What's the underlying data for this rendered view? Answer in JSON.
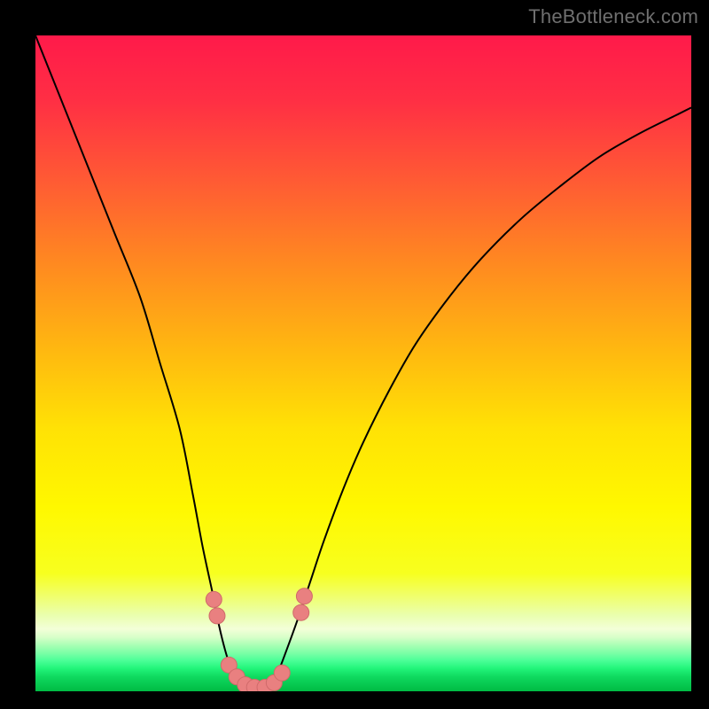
{
  "watermark": "TheBottleneck.com",
  "colors": {
    "frame": "#000000",
    "curve": "#000000",
    "marker_fill": "#e98080",
    "marker_stroke": "#d06a6a",
    "gradient_stops": [
      {
        "offset": 0.0,
        "color": "#ff1a4a"
      },
      {
        "offset": 0.1,
        "color": "#ff2f44"
      },
      {
        "offset": 0.22,
        "color": "#ff5a34"
      },
      {
        "offset": 0.35,
        "color": "#ff8a20"
      },
      {
        "offset": 0.48,
        "color": "#ffb810"
      },
      {
        "offset": 0.6,
        "color": "#ffe205"
      },
      {
        "offset": 0.72,
        "color": "#fff800"
      },
      {
        "offset": 0.82,
        "color": "#f7ff1f"
      },
      {
        "offset": 0.885,
        "color": "#eaffb0"
      },
      {
        "offset": 0.905,
        "color": "#f3ffd8"
      },
      {
        "offset": 0.918,
        "color": "#d6ffc8"
      },
      {
        "offset": 0.93,
        "color": "#a8ffb4"
      },
      {
        "offset": 0.942,
        "color": "#7affa6"
      },
      {
        "offset": 0.953,
        "color": "#4cff98"
      },
      {
        "offset": 0.965,
        "color": "#22f57a"
      },
      {
        "offset": 0.978,
        "color": "#0fd95f"
      },
      {
        "offset": 1.0,
        "color": "#00bb43"
      }
    ]
  },
  "chart_data": {
    "type": "line",
    "title": "",
    "xlabel": "",
    "ylabel": "",
    "xlim": [
      0,
      100
    ],
    "ylim": [
      0,
      100
    ],
    "series": [
      {
        "name": "curve",
        "x": [
          0,
          4,
          8,
          12,
          16,
          19,
          22,
          24,
          25.5,
          27,
          28,
          29,
          30,
          31,
          32,
          33,
          34,
          35,
          36,
          37,
          38,
          40,
          42,
          44,
          47,
          50,
          54,
          58,
          63,
          68,
          74,
          80,
          86,
          92,
          98,
          100
        ],
        "y": [
          100,
          90,
          80,
          70,
          60,
          50,
          40,
          30,
          22,
          15,
          10,
          6,
          3,
          1.5,
          0.6,
          0.2,
          0.2,
          0.6,
          1.5,
          3,
          5.5,
          11,
          17,
          23,
          31,
          38,
          46,
          53,
          60,
          66,
          72,
          77,
          81.5,
          85,
          88,
          89
        ]
      }
    ],
    "markers": [
      {
        "x": 27.2,
        "y": 14.0
      },
      {
        "x": 27.7,
        "y": 11.5
      },
      {
        "x": 29.5,
        "y": 4.0
      },
      {
        "x": 30.7,
        "y": 2.2
      },
      {
        "x": 32.0,
        "y": 1.0
      },
      {
        "x": 33.4,
        "y": 0.6
      },
      {
        "x": 35.0,
        "y": 0.6
      },
      {
        "x": 36.4,
        "y": 1.3
      },
      {
        "x": 37.6,
        "y": 2.8
      },
      {
        "x": 40.5,
        "y": 12.0
      },
      {
        "x": 41.0,
        "y": 14.5
      }
    ]
  }
}
